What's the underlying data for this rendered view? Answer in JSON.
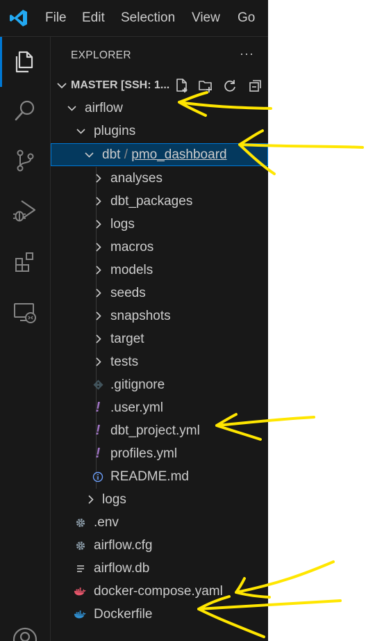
{
  "menu": [
    "File",
    "Edit",
    "Selection",
    "View",
    "Go"
  ],
  "sidebar": {
    "title": "EXPLORER",
    "more_glyph": "···",
    "folder_name": "MASTER [SSH: 1..."
  },
  "tree": [
    {
      "label": "airflow",
      "type": "folder",
      "expanded": true,
      "depth": 0
    },
    {
      "label": "plugins",
      "type": "folder",
      "expanded": true,
      "depth": 1
    },
    {
      "label_parts": [
        "dbt",
        " / ",
        "pmo_dashboard"
      ],
      "type": "folder",
      "expanded": true,
      "depth": 2,
      "selected": true
    },
    {
      "label": "analyses",
      "type": "folder",
      "expanded": false,
      "depth": 3
    },
    {
      "label": "dbt_packages",
      "type": "folder",
      "expanded": false,
      "depth": 3
    },
    {
      "label": "logs",
      "type": "folder",
      "expanded": false,
      "depth": 3
    },
    {
      "label": "macros",
      "type": "folder",
      "expanded": false,
      "depth": 3
    },
    {
      "label": "models",
      "type": "folder",
      "expanded": false,
      "depth": 3
    },
    {
      "label": "seeds",
      "type": "folder",
      "expanded": false,
      "depth": 3
    },
    {
      "label": "snapshots",
      "type": "folder",
      "expanded": false,
      "depth": 3
    },
    {
      "label": "target",
      "type": "folder",
      "expanded": false,
      "depth": 3
    },
    {
      "label": "tests",
      "type": "folder",
      "expanded": false,
      "depth": 3
    },
    {
      "label": ".gitignore",
      "type": "file",
      "icon": "git-icon",
      "depth": 3
    },
    {
      "label": ".user.yml",
      "type": "file",
      "icon": "yaml-exclamation-icon",
      "depth": 3
    },
    {
      "label": "dbt_project.yml",
      "type": "file",
      "icon": "yaml-exclamation-icon",
      "depth": 3
    },
    {
      "label": "profiles.yml",
      "type": "file",
      "icon": "yaml-exclamation-icon",
      "depth": 3
    },
    {
      "label": "README.md",
      "type": "file",
      "icon": "info-icon",
      "depth": 3
    },
    {
      "label": "logs",
      "type": "folder",
      "expanded": false,
      "depth": 2
    },
    {
      "label": ".env",
      "type": "file",
      "icon": "gear-icon",
      "depth": 1
    },
    {
      "label": "airflow.cfg",
      "type": "file",
      "icon": "gear-icon",
      "depth": 1
    },
    {
      "label": "airflow.db",
      "type": "file",
      "icon": "lines-icon",
      "depth": 1
    },
    {
      "label": "docker-compose.yaml",
      "type": "file",
      "icon": "docker-red-icon",
      "depth": 1
    },
    {
      "label": "Dockerfile",
      "type": "file",
      "icon": "docker-blue-icon",
      "depth": 1
    }
  ],
  "colors": {
    "accent": "#0078d4",
    "selected_bg": "#04395e",
    "yaml_icon": "#a074c4",
    "info_icon": "#6c9ef8",
    "docker_red": "#e8566b",
    "docker_blue": "#2f8ecf",
    "annotation": "#ffe600"
  }
}
